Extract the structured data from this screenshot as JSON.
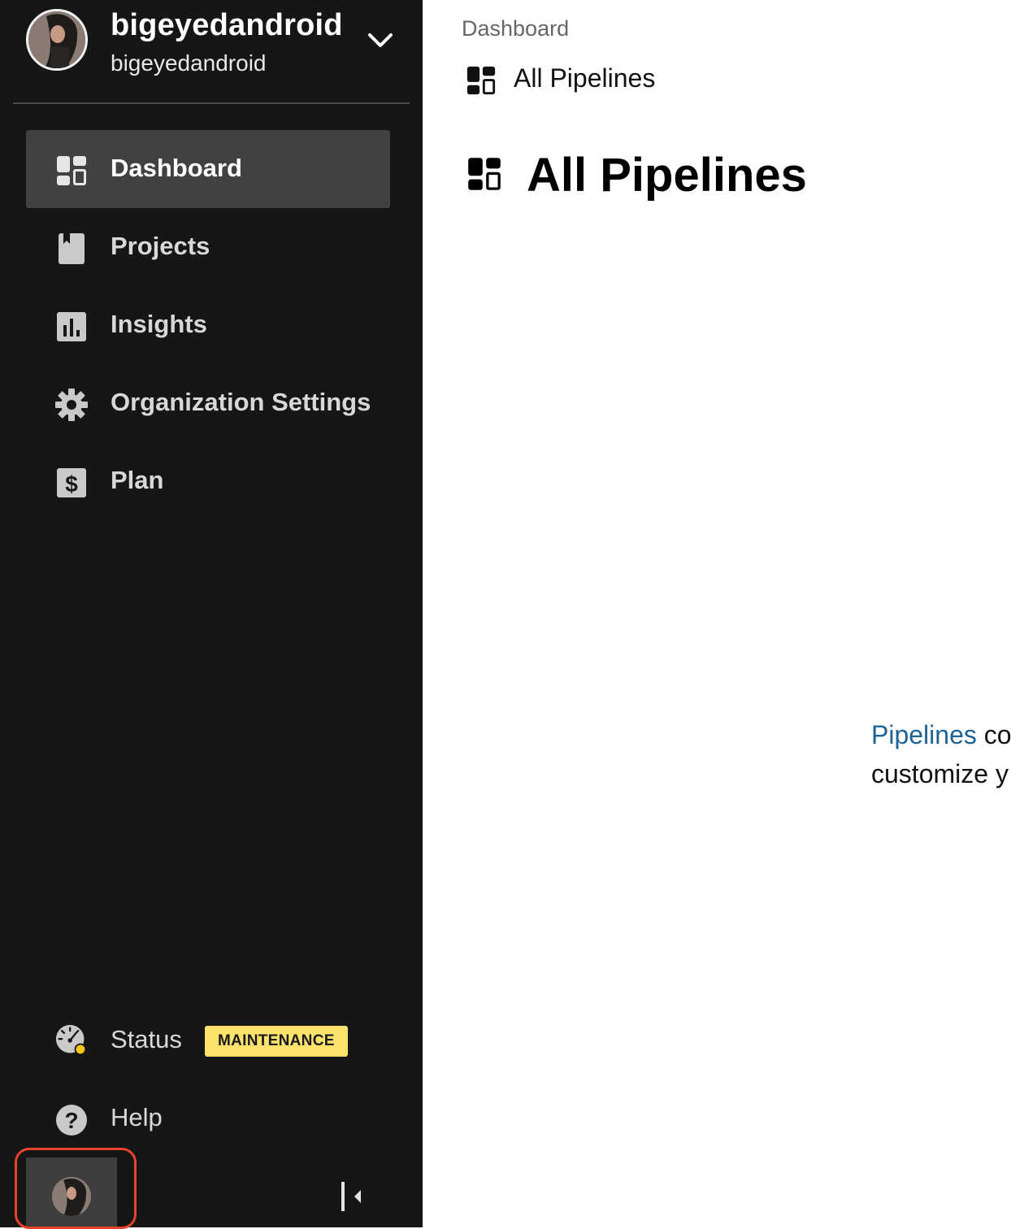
{
  "org": {
    "name": "bigeyedandroid",
    "handle": "bigeyedandroid"
  },
  "nav": {
    "items": [
      {
        "label": "Dashboard",
        "icon": "dashboard-icon",
        "active": true
      },
      {
        "label": "Projects",
        "icon": "book-icon",
        "active": false
      },
      {
        "label": "Insights",
        "icon": "bar-chart-icon",
        "active": false
      },
      {
        "label": "Organization Settings",
        "icon": "gear-icon",
        "active": false
      },
      {
        "label": "Plan",
        "icon": "dollar-icon",
        "active": false
      }
    ],
    "status": {
      "label": "Status",
      "badge": "MAINTENANCE",
      "icon": "speedometer-icon"
    },
    "help": {
      "label": "Help",
      "icon": "question-icon"
    }
  },
  "breadcrumb": {
    "root": "Dashboard",
    "current": "All Pipelines"
  },
  "page": {
    "title": "All Pipelines"
  },
  "empty_state": {
    "link": "Pipelines",
    "line1_rest": " co",
    "line2": "customize y"
  },
  "colors": {
    "sidebar_bg": "#161616",
    "active_item_bg": "#414141",
    "badge_bg": "#fbe26d",
    "link": "#1e6398",
    "highlight": "#e8432c"
  }
}
